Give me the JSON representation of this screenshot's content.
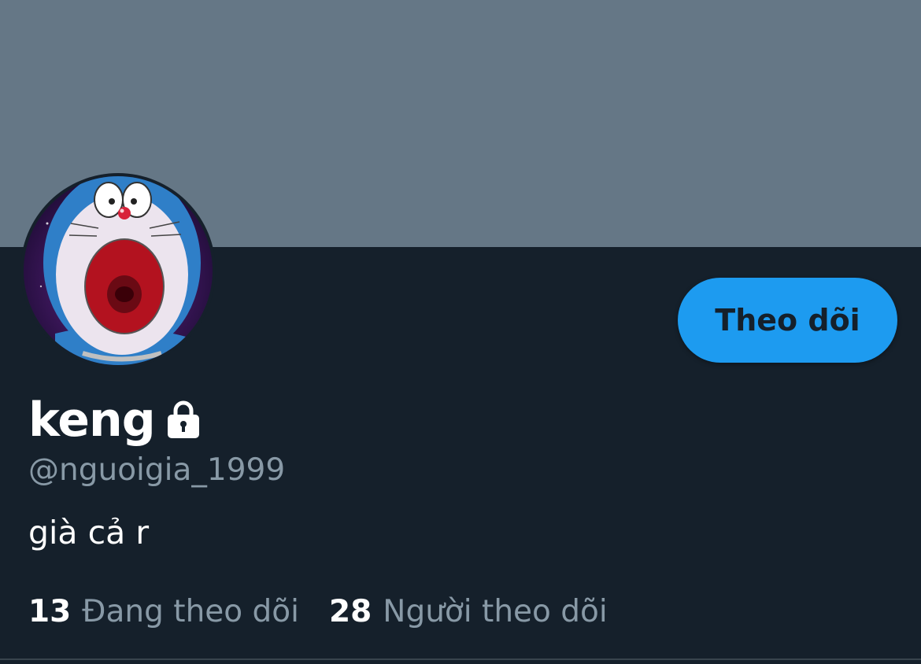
{
  "profile": {
    "display_name": "keng",
    "handle": "@nguoigia_1999",
    "bio": "già cả r",
    "protected_icon": "lock-icon",
    "avatar": "doraemon-screaming-avatar"
  },
  "actions": {
    "follow_label": "Theo dõi"
  },
  "stats": {
    "following_count": "13",
    "following_label": "Đang theo dõi",
    "followers_count": "28",
    "followers_label": "Người theo dõi"
  },
  "colors": {
    "background": "#15202b",
    "banner": "#657786",
    "accent": "#1d9bf0",
    "secondary_text": "#8899a6"
  }
}
